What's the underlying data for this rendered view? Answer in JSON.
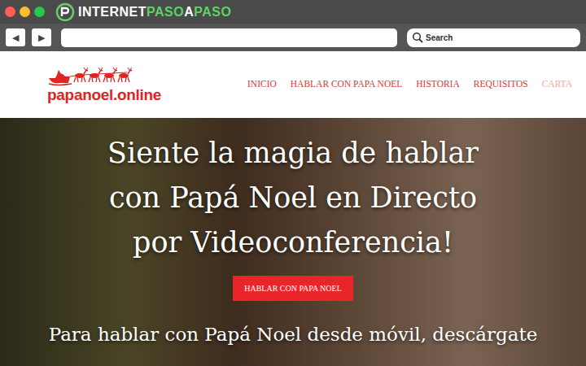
{
  "browser": {
    "window_controls": [
      {
        "color": "#ff5f57"
      },
      {
        "color": "#febc2e"
      },
      {
        "color": "#2ac84a"
      }
    ],
    "brand": [
      {
        "text": "INTERNET",
        "color": "#ffffff"
      },
      {
        "text": "PASO",
        "color": "#5fd068"
      },
      {
        "text": "A",
        "color": "#ffffff"
      },
      {
        "text": "PASO",
        "color": "#5fd068"
      }
    ],
    "back_button": "◀",
    "forward_button": "▶",
    "address": "",
    "search": {
      "placeholder": "Search"
    }
  },
  "site": {
    "logo": "papanoel.online",
    "nav": [
      {
        "label": "INICIO",
        "selected": false
      },
      {
        "label": "HABLAR CON PAPA NOEL",
        "selected": false
      },
      {
        "label": "HISTORIA",
        "selected": false
      },
      {
        "label": "REQUISITOS",
        "selected": false
      },
      {
        "label": "CARTA",
        "selected": true
      }
    ],
    "hero": {
      "title_lines": [
        "Siente la magia de hablar",
        "con Papá Noel en Directo",
        "por Videoconferencia!"
      ],
      "button": "HABLAR CON PAPA NOEL",
      "subtitle": "Para hablar con Papá Noel desde móvil, descárgate"
    }
  }
}
